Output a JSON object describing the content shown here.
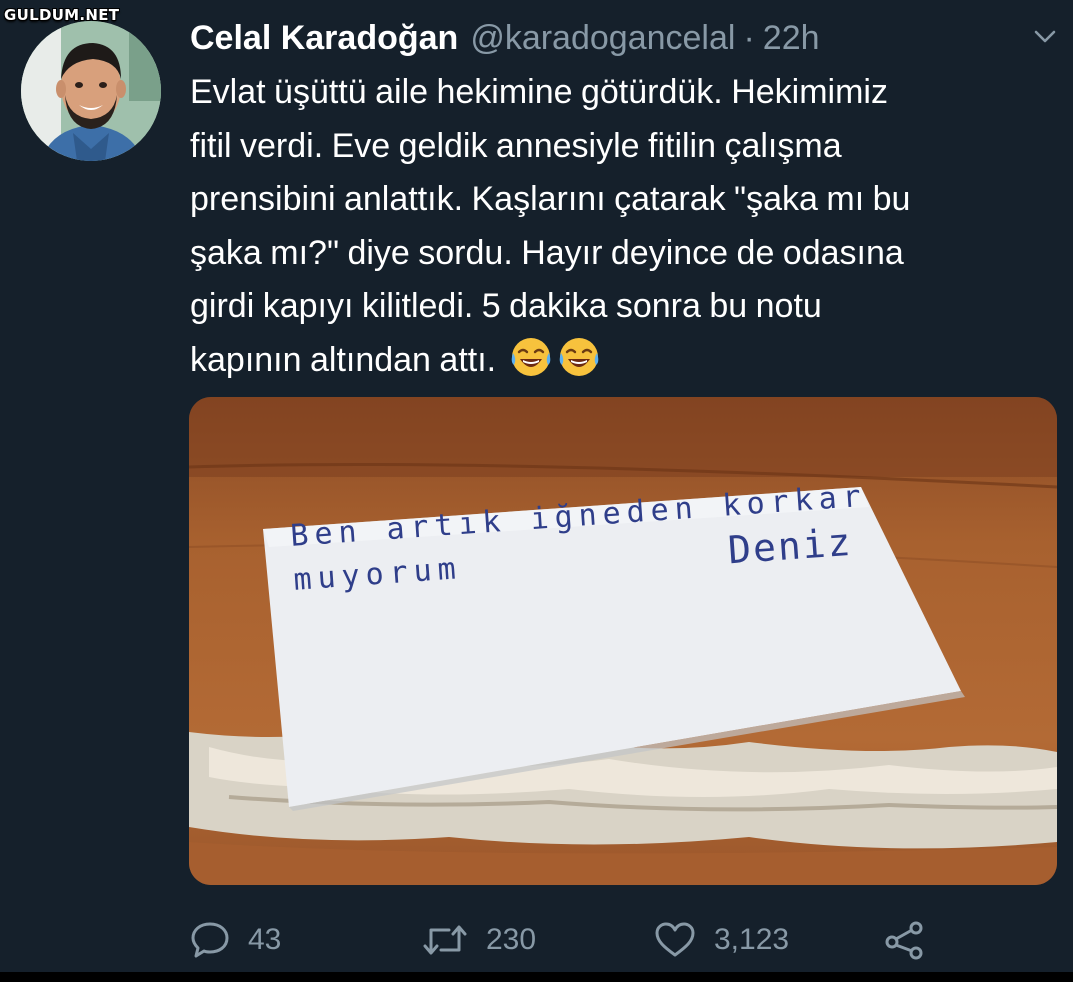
{
  "watermark": "GULDUM.NET",
  "tweet": {
    "display_name": "Celal Karadoğan",
    "handle": "@karadogancelal",
    "separator": "·",
    "time": "22h",
    "text_lines": [
      "Evlat üşüttü aile hekimine götürdük. Hekimimiz",
      "fitil verdi. Eve geldik annesiyle fitilin çalışma",
      "prensibini anlattık. Kaşlarını çatarak \"şaka mı bu",
      "şaka mı?\" diye sordu. Hayır deyince de odasına",
      "girdi kapıyı kilitledi. 5 dakika sonra bu notu",
      "kapının altından attı."
    ],
    "emoji": [
      "face-with-tears-of-joy",
      "face-with-tears-of-joy"
    ],
    "note": {
      "line1": "Ben artık iğneden korkar",
      "line2": "muyorum",
      "signature": "Deniz"
    },
    "stats": {
      "replies": "43",
      "retweets": "230",
      "likes": "3,123"
    },
    "icons": [
      "reply-icon",
      "retweet-icon",
      "like-icon",
      "share-icon",
      "chevron-down-icon"
    ],
    "colors": {
      "background": "#15202b",
      "secondary_text": "#8899a6",
      "primary_text": "#ffffff"
    }
  }
}
